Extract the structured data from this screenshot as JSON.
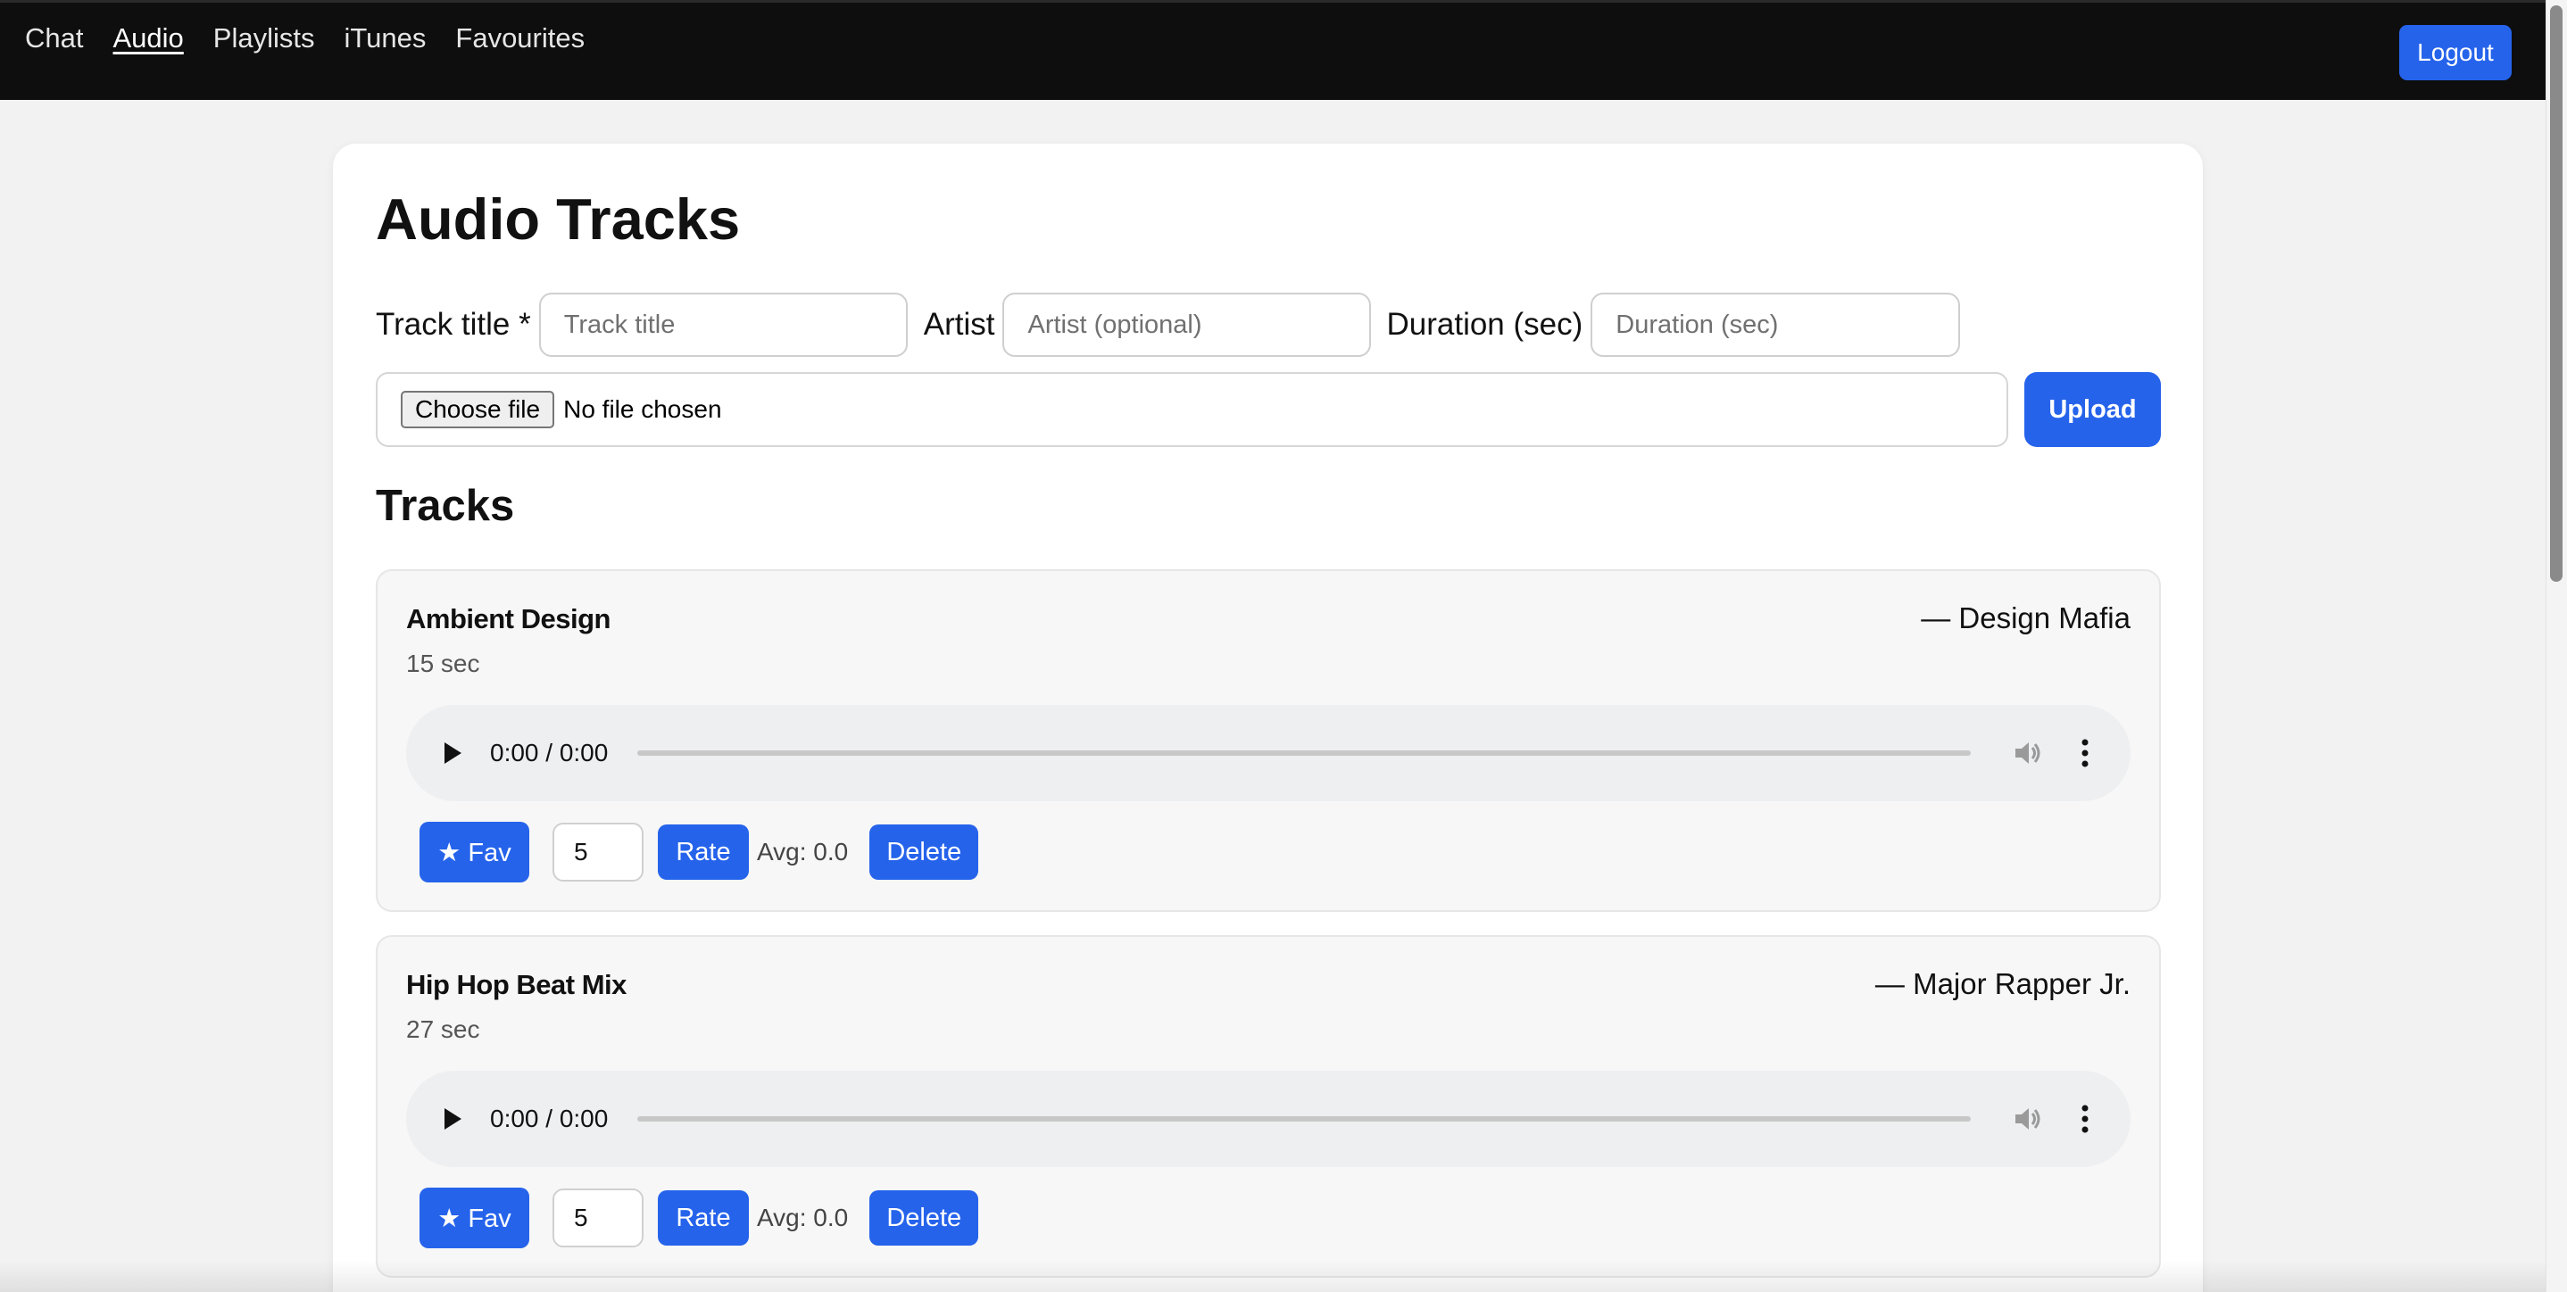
{
  "nav": {
    "links": [
      "Chat",
      "Audio",
      "Playlists",
      "iTunes",
      "Favourites"
    ],
    "active": "Audio",
    "logout_label": "Logout"
  },
  "page": {
    "title": "Audio Tracks",
    "form": {
      "title_label": "Track title *",
      "title_placeholder": "Track title",
      "artist_label": "Artist",
      "artist_placeholder": "Artist (optional)",
      "duration_label": "Duration (sec)",
      "duration_placeholder": "Duration (sec)",
      "choose_file_label": "Choose file",
      "file_status": "No file chosen",
      "upload_label": "Upload"
    },
    "tracks_heading": "Tracks"
  },
  "tracks": [
    {
      "title": "Ambient Design",
      "artist": "— Design Mafia",
      "duration": "15 sec",
      "player_time": "0:00 / 0:00",
      "fav_label": "★ Fav",
      "rating_value": "5",
      "rate_label": "Rate",
      "avg": "Avg: 0.0",
      "delete_label": "Delete"
    },
    {
      "title": "Hip Hop Beat Mix",
      "artist": "— Major Rapper Jr.",
      "duration": "27 sec",
      "player_time": "0:00 / 0:00",
      "fav_label": "★ Fav",
      "rating_value": "5",
      "rate_label": "Rate",
      "avg": "Avg: 0.0",
      "delete_label": "Delete"
    }
  ],
  "colors": {
    "accent": "#2563eb",
    "navbar": "#0e0e0e",
    "background": "#f2f2f2"
  }
}
